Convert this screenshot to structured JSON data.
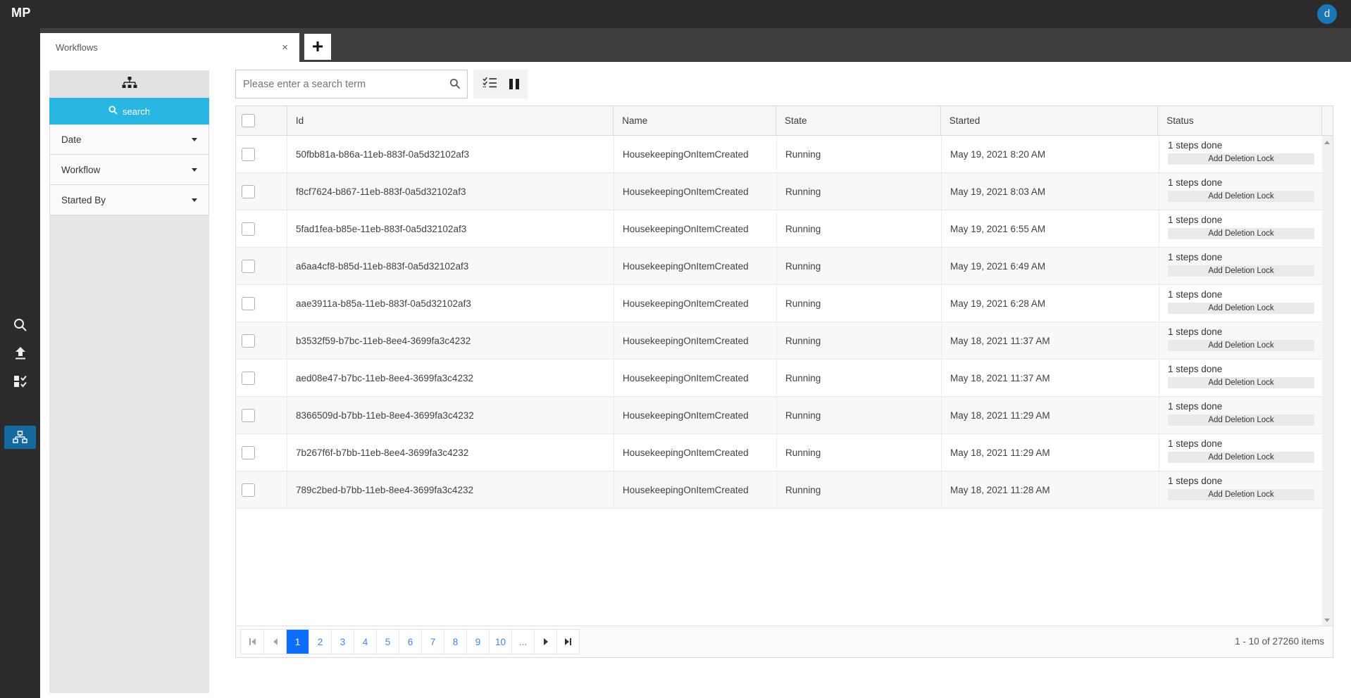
{
  "colors": {
    "accent_cyan": "#29b6e3",
    "rail_active_blue": "#15699e",
    "avatar_blue": "#1b77b5",
    "active_page_blue": "#0d6efd"
  },
  "topbar": {
    "logo": "MP",
    "avatar_initial": "d"
  },
  "tabstrip": {
    "active_tab": "Workflows",
    "close_icon": "×",
    "new_tab_icon": "+"
  },
  "rail": {
    "items": [
      {
        "icon": "search-icon",
        "active": false
      },
      {
        "icon": "upload-icon",
        "active": false
      },
      {
        "icon": "tasks-icon",
        "active": false
      },
      {
        "icon": "workflows-icon",
        "active": true
      }
    ]
  },
  "filter_panel": {
    "header_icon": "sitemap-icon",
    "search_button": "search",
    "sections": [
      {
        "label": "Date"
      },
      {
        "label": "Workflow"
      },
      {
        "label": "Started By"
      }
    ]
  },
  "toolbar": {
    "search_placeholder": "Please enter a search term",
    "icons": [
      "search-icon",
      "task-list-icon",
      "pause-icon"
    ]
  },
  "grid": {
    "columns": [
      "Id",
      "Name",
      "State",
      "Started",
      "Status"
    ],
    "rows": [
      {
        "id": "50fbb81a-b86a-11eb-883f-0a5d32102af3",
        "name": "HousekeepingOnItemCreated",
        "state": "Running",
        "started": "May 19, 2021 8:20 AM",
        "steps": "1 steps done",
        "action": "Add Deletion Lock"
      },
      {
        "id": "f8cf7624-b867-11eb-883f-0a5d32102af3",
        "name": "HousekeepingOnItemCreated",
        "state": "Running",
        "started": "May 19, 2021 8:03 AM",
        "steps": "1 steps done",
        "action": "Add Deletion Lock"
      },
      {
        "id": "5fad1fea-b85e-11eb-883f-0a5d32102af3",
        "name": "HousekeepingOnItemCreated",
        "state": "Running",
        "started": "May 19, 2021 6:55 AM",
        "steps": "1 steps done",
        "action": "Add Deletion Lock"
      },
      {
        "id": "a6aa4cf8-b85d-11eb-883f-0a5d32102af3",
        "name": "HousekeepingOnItemCreated",
        "state": "Running",
        "started": "May 19, 2021 6:49 AM",
        "steps": "1 steps done",
        "action": "Add Deletion Lock"
      },
      {
        "id": "aae3911a-b85a-11eb-883f-0a5d32102af3",
        "name": "HousekeepingOnItemCreated",
        "state": "Running",
        "started": "May 19, 2021 6:28 AM",
        "steps": "1 steps done",
        "action": "Add Deletion Lock"
      },
      {
        "id": "b3532f59-b7bc-11eb-8ee4-3699fa3c4232",
        "name": "HousekeepingOnItemCreated",
        "state": "Running",
        "started": "May 18, 2021 11:37 AM",
        "steps": "1 steps done",
        "action": "Add Deletion Lock"
      },
      {
        "id": "aed08e47-b7bc-11eb-8ee4-3699fa3c4232",
        "name": "HousekeepingOnItemCreated",
        "state": "Running",
        "started": "May 18, 2021 11:37 AM",
        "steps": "1 steps done",
        "action": "Add Deletion Lock"
      },
      {
        "id": "8366509d-b7bb-11eb-8ee4-3699fa3c4232",
        "name": "HousekeepingOnItemCreated",
        "state": "Running",
        "started": "May 18, 2021 11:29 AM",
        "steps": "1 steps done",
        "action": "Add Deletion Lock"
      },
      {
        "id": "7b267f6f-b7bb-11eb-8ee4-3699fa3c4232",
        "name": "HousekeepingOnItemCreated",
        "state": "Running",
        "started": "May 18, 2021 11:29 AM",
        "steps": "1 steps done",
        "action": "Add Deletion Lock"
      },
      {
        "id": "789c2bed-b7bb-11eb-8ee4-3699fa3c4232",
        "name": "HousekeepingOnItemCreated",
        "state": "Running",
        "started": "May 18, 2021 11:28 AM",
        "steps": "1 steps done",
        "action": "Add Deletion Lock"
      }
    ]
  },
  "pager": {
    "current": "1",
    "pages": [
      "1",
      "2",
      "3",
      "4",
      "5",
      "6",
      "7",
      "8",
      "9",
      "10",
      "..."
    ],
    "summary": "1 - 10 of 27260 items"
  }
}
